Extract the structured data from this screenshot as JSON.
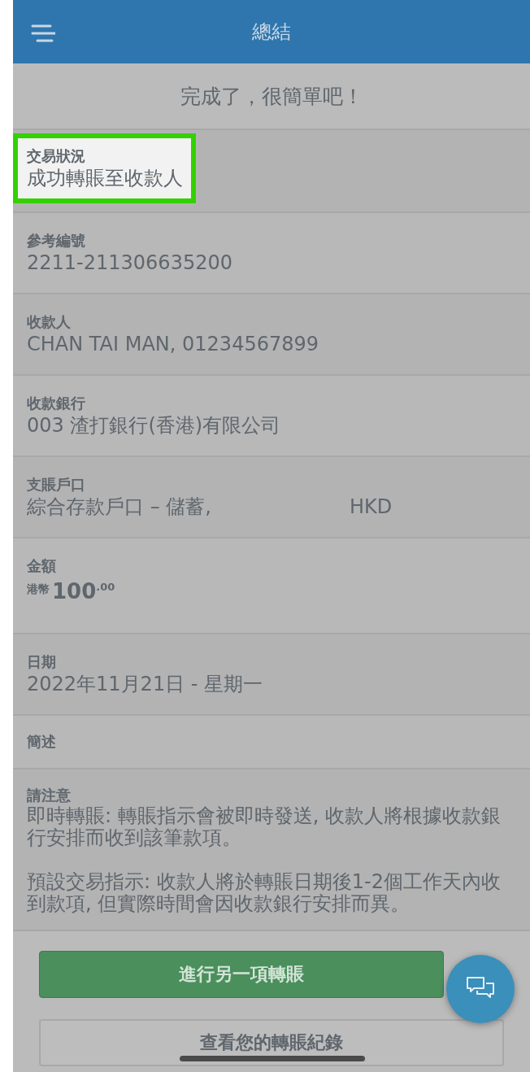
{
  "app_bar": {
    "title": "總結"
  },
  "banner": "完成了，很簡單吧！",
  "fields": [
    {
      "kind": "text",
      "label": "交易狀況",
      "value": "成功轉賬至收款人",
      "highlighted": true
    },
    {
      "kind": "text",
      "label": "參考編號",
      "value": "2211-211306635200",
      "highlighted": false
    },
    {
      "kind": "text",
      "label": "收款人",
      "value": "CHAN TAI MAN, 01234567899",
      "highlighted": false
    },
    {
      "kind": "text",
      "label": "收款銀行",
      "value": "003 渣打銀行(香港)有限公司",
      "highlighted": false
    },
    {
      "kind": "account",
      "label": "支賬戶口",
      "value": "綜合存款戶口 – 儲蓄,",
      "currency": "HKD",
      "highlighted": false
    },
    {
      "kind": "amount",
      "label": "金額",
      "currency": "港幣",
      "integer": "100",
      "decimals": ".00",
      "highlighted": false
    },
    {
      "kind": "text",
      "label": "日期",
      "value": "2022年11月21日 - 星期一",
      "highlighted": false
    },
    {
      "kind": "label",
      "label": "簡述",
      "highlighted": false
    },
    {
      "kind": "notice",
      "label": "請注意",
      "paragraphs": [
        "即時轉賬: 轉賬指示會被即時發送, 收款人將根據收款銀行安排而收到該筆款項。",
        "預設交易指示: 收款人將於轉賬日期後1-2個工作天內收到款項, 但實際時間會因收款銀行安排而異。"
      ],
      "highlighted": false
    }
  ],
  "buttons": [
    {
      "kind": "primary",
      "label": "進行另一項轉賬"
    },
    {
      "kind": "secondary",
      "label": "查看您的轉賬紀錄"
    }
  ]
}
